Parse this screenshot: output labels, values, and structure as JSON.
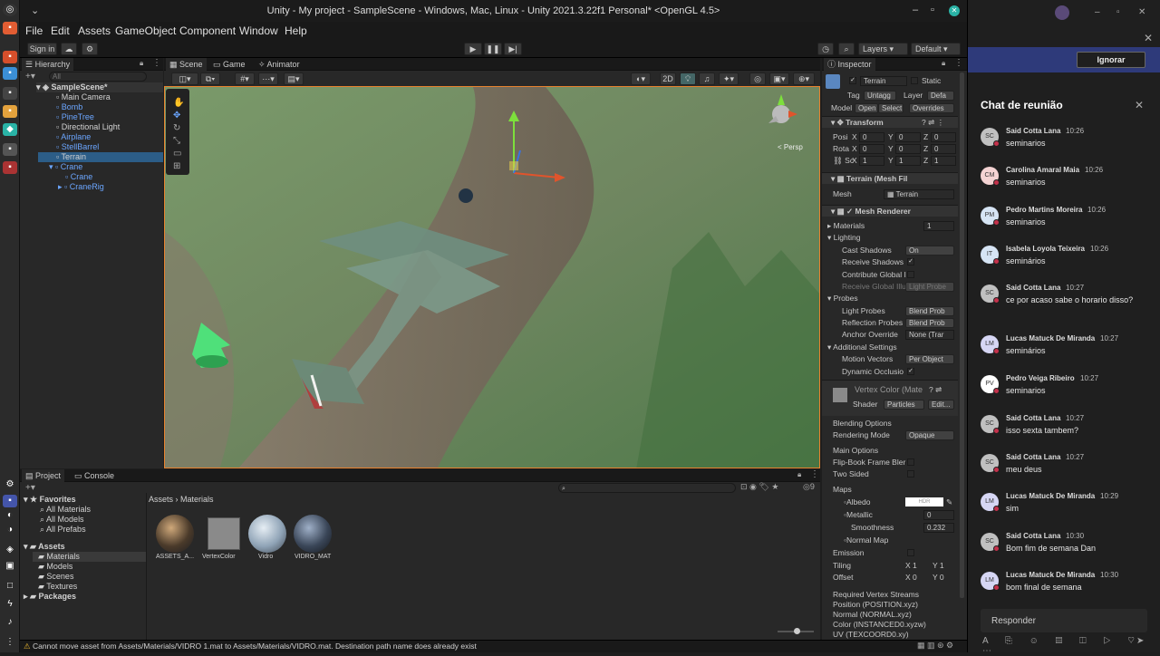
{
  "window": {
    "title": "Unity - My project - SampleScene - Windows, Mac, Linux - Unity 2021.3.22f1 Personal* <OpenGL 4.5>"
  },
  "menu": [
    "File",
    "Edit",
    "Assets",
    "GameObject",
    "Component",
    "Window",
    "Help"
  ],
  "toolbar": {
    "sign_in": "Sign in",
    "layers": "Layers",
    "layout": "Default"
  },
  "hierarchy": {
    "tab": "Hierarchy",
    "search": "All",
    "scene": "SampleScene*",
    "items": [
      "Main Camera",
      "Bomb",
      "PineTree",
      "Directional Light",
      "Airplane",
      "StellBarrel",
      "Terrain",
      "Crane",
      "Crane",
      "CraneRig"
    ]
  },
  "scene_tabs": {
    "scene": "Scene",
    "game": "Game",
    "animator": "Animator",
    "mode2d": "2D",
    "persp": "< Persp"
  },
  "inspector": {
    "tab": "Inspector",
    "name": "Terrain",
    "static": "Static",
    "tag_label": "Tag",
    "tag": "Untagg",
    "layer_label": "Layer",
    "layer": "Defa",
    "model_label": "Model",
    "open": "Open",
    "select": "Select",
    "overrides": "Overrides",
    "transform": "Transform",
    "pos": "Posi",
    "rot": "Rota",
    "scale": "Sc",
    "pos_vals": [
      "0",
      "0",
      "0"
    ],
    "rot_vals": [
      "0",
      "0",
      "0"
    ],
    "scale_vals": [
      "1",
      "1",
      "1"
    ],
    "axis": [
      "X",
      "Y",
      "Z"
    ],
    "meshfilter": "Terrain (Mesh Fil",
    "mesh_label": "Mesh",
    "mesh": "Terrain",
    "meshrenderer": "Mesh Renderer",
    "materials": "Materials",
    "materials_count": "1",
    "lighting": "Lighting",
    "cast_shadows": "Cast Shadows",
    "cast_val": "On",
    "receive_shadows": "Receive Shadows",
    "contrib_gi": "Contribute Global I",
    "receive_gi": "Receive Global Illu",
    "receive_gi_val": "Light Probe",
    "probes": "Probes",
    "light_probes": "Light Probes",
    "light_probes_val": "Blend Prob",
    "refl_probes": "Reflection Probes",
    "refl_val": "Blend Prob",
    "anchor": "Anchor Override",
    "anchor_val": "None (Trar",
    "additional": "Additional Settings",
    "motion": "Motion Vectors",
    "motion_val": "Per Object",
    "dynocc": "Dynamic Occlusio",
    "mat_name": "Vertex Color (Mate",
    "shader_label": "Shader",
    "shader": "Particles",
    "edit": "Edit...",
    "blending": "Blending Options",
    "render_mode": "Rendering Mode",
    "render_val": "Opaque",
    "main_opts": "Main Options",
    "flipbook": "Flip-Book Frame Bler",
    "two_sided": "Two Sided",
    "maps": "Maps",
    "albedo": "Albedo",
    "hdr": "HDR",
    "metallic": "Metallic",
    "metallic_val": "0",
    "smoothness": "Smoothness",
    "smooth_val": "0.232",
    "normal": "Normal Map",
    "emission": "Emission",
    "tiling": "Tiling",
    "tiling_vals": [
      "1",
      "1"
    ],
    "offset": "Offset",
    "offset_vals": [
      "0",
      "0"
    ],
    "req_streams": "Required Vertex Streams",
    "streams": [
      "Position (POSITION.xyz)",
      "Normal (NORMAL.xyz)",
      "Color (INSTANCED0.xyzw)",
      "UV (TEXCOORD0.xy)"
    ]
  },
  "project": {
    "tab": "Project",
    "console": "Console",
    "favorites": "Favorites",
    "fav_items": [
      "All Materials",
      "All Models",
      "All Prefabs"
    ],
    "assets": "Assets",
    "asset_items": [
      "Materials",
      "Models",
      "Scenes",
      "Textures"
    ],
    "packages": "Packages",
    "breadcrumb": [
      "Assets",
      "Materials"
    ],
    "files": [
      "ASSETS_A...",
      "VertexColor",
      "Vidro",
      "VIDRO_MAT"
    ],
    "count": "9"
  },
  "status": "Cannot move asset from Assets/Materials/VIDRO 1.mat to Assets/Materials/VIDRO.mat. Destination path name does already exist",
  "chat": {
    "ignore": "Ignorar",
    "title": "Chat de reunião",
    "reply": "Responder",
    "messages": [
      {
        "initials": "SC",
        "name": "Said Cotta Lana",
        "time": "10:26",
        "text": "seminarios",
        "color": "#c0c0c0"
      },
      {
        "initials": "CM",
        "name": "Carolina Amaral Maia",
        "time": "10:26",
        "text": "seminarios",
        "color": "#f4d3d3"
      },
      {
        "initials": "PM",
        "name": "Pedro Martins Moreira",
        "time": "10:26",
        "text": "seminarios",
        "color": "#d6e4f4"
      },
      {
        "initials": "IT",
        "name": "Isabela Loyola Teixeira",
        "time": "10:26",
        "text": "seminários",
        "color": "#d6e4f4"
      },
      {
        "initials": "SC",
        "name": "Said Cotta Lana",
        "time": "10:27",
        "text": "ce por acaso sabe o horario disso?",
        "color": "#c0c0c0"
      },
      {
        "initials": "LM",
        "name": "Lucas Matuck De Miranda",
        "time": "10:27",
        "text": "seminários",
        "color": "#d6d6f4"
      },
      {
        "initials": "PV",
        "name": "Pedro Veiga Ribeiro",
        "time": "10:27",
        "text": "seminarios",
        "color": "#ffffff"
      },
      {
        "initials": "SC",
        "name": "Said Cotta Lana",
        "time": "10:27",
        "text": "isso sexta tambem?",
        "color": "#c0c0c0"
      },
      {
        "initials": "SC",
        "name": "Said Cotta Lana",
        "time": "10:27",
        "text": "meu deus",
        "color": "#c0c0c0"
      },
      {
        "initials": "LM",
        "name": "Lucas Matuck De Miranda",
        "time": "10:29",
        "text": "sim",
        "color": "#d6d6f4"
      },
      {
        "initials": "SC",
        "name": "Said Cotta Lana",
        "time": "10:30",
        "text": "Bom fim de semana Dan",
        "color": "#c0c0c0"
      },
      {
        "initials": "LM",
        "name": "Lucas Matuck De Miranda",
        "time": "10:30",
        "text": "bom final de semana",
        "color": "#d6d6f4"
      }
    ]
  }
}
